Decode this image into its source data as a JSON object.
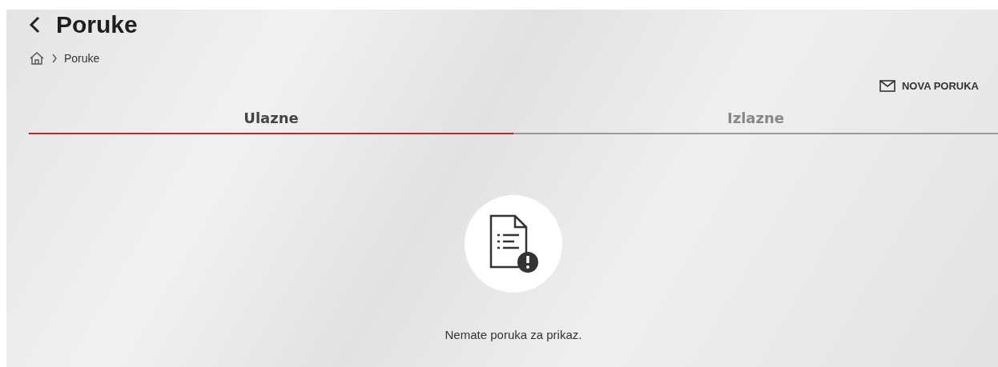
{
  "header": {
    "title": "Poruke"
  },
  "breadcrumb": [
    {
      "label": "Poruke"
    }
  ],
  "actions": [
    {
      "label": "NOVA PORUKA"
    }
  ],
  "tabs": [
    {
      "label": "Ulazne",
      "selected": true
    },
    {
      "label": "Izlazne",
      "selected": false
    }
  ],
  "empty_state": {
    "message": "Nemate poruka za prikaz."
  }
}
